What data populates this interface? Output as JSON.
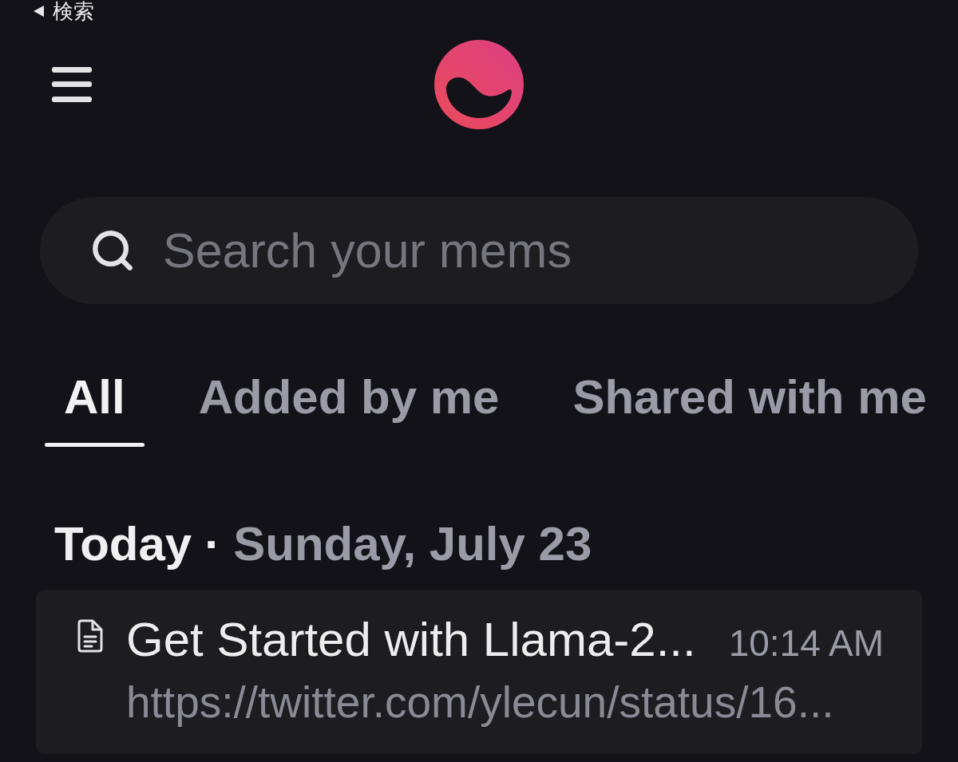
{
  "status_bar": {
    "back_label": "検索"
  },
  "search": {
    "placeholder": "Search your mems"
  },
  "tabs": [
    {
      "label": "All",
      "selected": true
    },
    {
      "label": "Added by me",
      "selected": false
    },
    {
      "label": "Shared with me",
      "selected": false
    }
  ],
  "section": {
    "day": "Today",
    "separator": "·",
    "date": "Sunday, July 23"
  },
  "mems": [
    {
      "title": "Get Started with Llama-2...",
      "time": "10:14 AM",
      "url": "https://twitter.com/ylecun/status/16..."
    }
  ]
}
